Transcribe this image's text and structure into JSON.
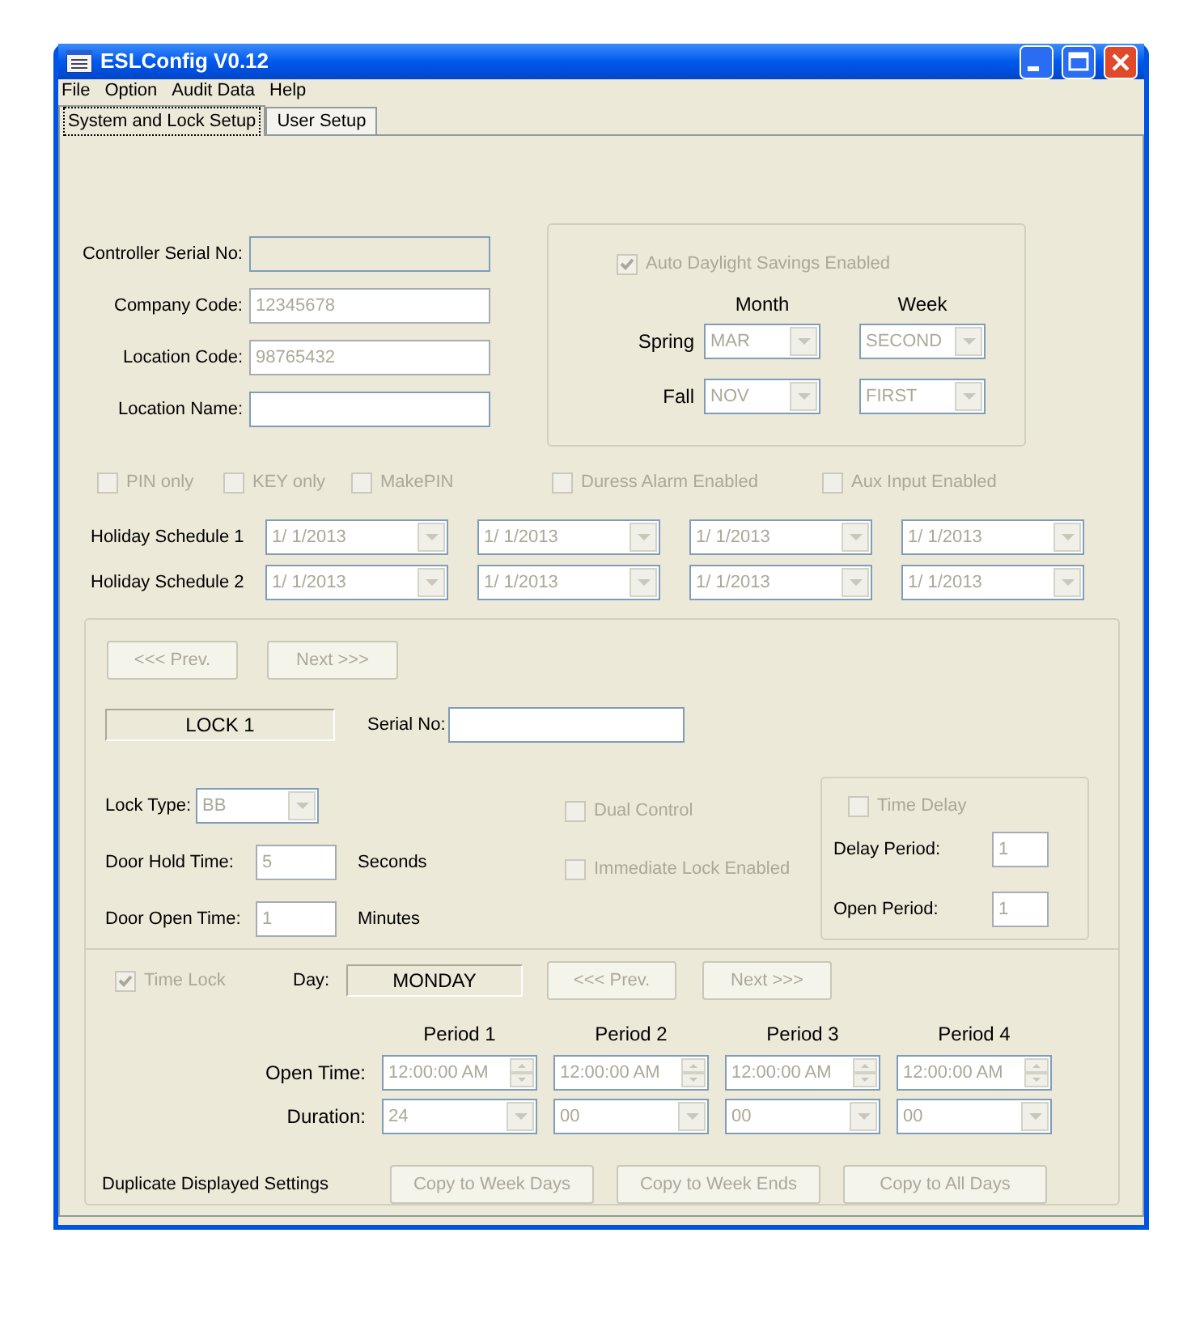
{
  "window": {
    "title": "ESLConfig V0.12"
  },
  "menu": [
    "File",
    "Option",
    "Audit Data",
    "Help"
  ],
  "tabs": [
    {
      "label": "System and Lock Setup",
      "selected": true
    },
    {
      "label": "User Setup",
      "selected": false
    }
  ],
  "identity": [
    {
      "label": "Controller Serial No:",
      "readonly": true,
      "disabled": false
    },
    {
      "label": "Company Code:",
      "value": "12345678",
      "readonly": false,
      "disabled": true
    },
    {
      "label": "Location Code:",
      "value": "98765432",
      "readonly": false,
      "disabled": true
    },
    {
      "label": "Location Name:",
      "readonly": false,
      "disabled": false
    }
  ],
  "daylight": {
    "checkbox": {
      "label": "Auto Daylight Savings Enabled",
      "checked": true,
      "disabled": true
    },
    "columns": [
      "Month",
      "Week"
    ],
    "rows": [
      {
        "label": "Spring",
        "month": "MAR",
        "week": "SECOND",
        "disabled": true
      },
      {
        "label": "Fall",
        "month": "NOV",
        "week": "FIRST",
        "disabled": true
      }
    ]
  },
  "options": [
    {
      "label": "PIN only",
      "checked": false,
      "disabled": true
    },
    {
      "label": "KEY only",
      "checked": false,
      "disabled": true
    },
    {
      "label": "MakePIN",
      "checked": false,
      "disabled": true
    },
    {
      "label": "Duress Alarm Enabled",
      "checked": false,
      "disabled": true
    },
    {
      "label": "Aux Input Enabled",
      "checked": false,
      "disabled": true
    }
  ],
  "holidays": [
    {
      "label": "Holiday Schedule 1",
      "dates": [
        "1/ 1/2013",
        "1/ 1/2013",
        "1/ 1/2013",
        "1/ 1/2013"
      ]
    },
    {
      "label": "Holiday Schedule 2",
      "dates": [
        "1/ 1/2013",
        "1/ 1/2013",
        "1/ 1/2013",
        "1/ 1/2013"
      ]
    }
  ],
  "lock": {
    "buttons": [
      {
        "label": "<<< Prev.",
        "disabled": true
      },
      {
        "label": "Next >>>",
        "disabled": true
      }
    ],
    "name": "LOCK 1",
    "serial_label": "Serial No:",
    "lock_type": {
      "label": "Lock Type:",
      "value": "BB",
      "disabled": true
    },
    "door_hold": {
      "label": "Door Hold Time:",
      "value": "5",
      "unit": "Seconds",
      "disabled": true
    },
    "door_open": {
      "label": "Door Open Time:",
      "value": "1",
      "unit": "Minutes",
      "disabled": true
    },
    "checks": [
      {
        "label": "Dual Control",
        "checked": false,
        "disabled": true
      },
      {
        "label": "Immediate Lock Enabled",
        "checked": false,
        "disabled": true
      }
    ],
    "time_delay": {
      "label": "Time Delay",
      "checked": false,
      "disabled": true,
      "fields": [
        {
          "label": "Delay Period:",
          "value": "1",
          "disabled": true
        },
        {
          "label": "Open Period:",
          "value": "1",
          "disabled": true
        }
      ]
    }
  },
  "time_lock": {
    "checkbox": {
      "label": "Time Lock",
      "checked": true,
      "disabled": true
    },
    "day_label": "Day:",
    "day": "MONDAY",
    "buttons": [
      {
        "label": "<<< Prev.",
        "disabled": true
      },
      {
        "label": "Next >>>",
        "disabled": true
      }
    ],
    "periods": [
      "Period 1",
      "Period 2",
      "Period 3",
      "Period 4"
    ],
    "open_time_label": "Open Time:",
    "open_times": [
      "12:00:00 AM",
      "12:00:00 AM",
      "12:00:00 AM",
      "12:00:00 AM"
    ],
    "duration_label": "Duration:",
    "durations": [
      "24",
      "00",
      "00",
      "00"
    ],
    "disabled": true,
    "duplicate_label": "Duplicate Displayed Settings",
    "copy_buttons": [
      {
        "label": "Copy to Week Days",
        "disabled": true
      },
      {
        "label": "Copy to Week Ends",
        "disabled": true
      },
      {
        "label": "Copy to All Days",
        "disabled": true
      }
    ]
  }
}
